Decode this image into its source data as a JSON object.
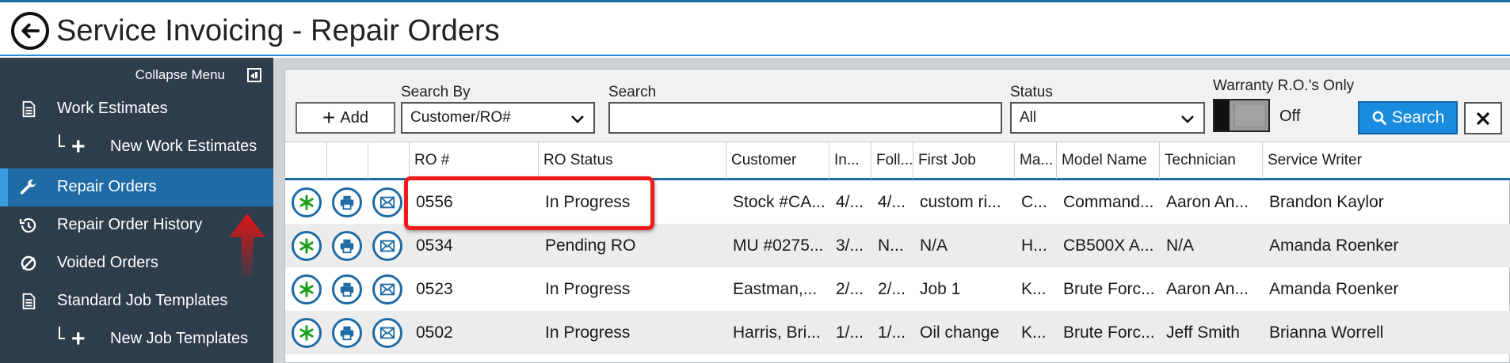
{
  "header": {
    "title": "Service Invoicing - Repair Orders"
  },
  "sidebar": {
    "collapse_label": "Collapse Menu",
    "items": [
      {
        "label": "Work Estimates",
        "icon": "document-icon"
      },
      {
        "label": "New Work Estimates",
        "icon": "plus-icon"
      },
      {
        "label": "Repair Orders",
        "icon": "wrench-icon",
        "active": true
      },
      {
        "label": "Repair Order History",
        "icon": "history-icon"
      },
      {
        "label": "Voided Orders",
        "icon": "void-icon"
      },
      {
        "label": "Standard Job Templates",
        "icon": "document-icon"
      },
      {
        "label": "New Job Templates",
        "icon": "plus-icon"
      }
    ]
  },
  "toolbar": {
    "add_label": "Add",
    "search_by_label": "Search By",
    "search_by_value": "Customer/RO#",
    "search_label": "Search",
    "search_value": "",
    "status_label": "Status",
    "status_value": "All",
    "warranty_label": "Warranty R.O.'s Only",
    "warranty_state": "Off",
    "search_button": "Search"
  },
  "table": {
    "columns": [
      "RO #",
      "RO Status",
      "Customer",
      "In...",
      "Foll...",
      "First Job",
      "Ma...",
      "Model Name",
      "Technician",
      "Service Writer"
    ],
    "rows": [
      [
        "0556",
        "In Progress",
        "Stock #CA...",
        "4/...",
        "4/...",
        "custom ri...",
        "C...",
        "Command...",
        "Aaron An...",
        "Brandon Kaylor"
      ],
      [
        "0534",
        "Pending RO",
        "MU #0275...",
        "3/...",
        "N...",
        "N/A",
        "H...",
        "CB500X A...",
        "N/A",
        "Amanda Roenker"
      ],
      [
        "0523",
        "In Progress",
        "Eastman,...",
        "2/...",
        "2/...",
        "Job 1",
        "K...",
        "Brute Forc...",
        "Aaron An...",
        "Amanda Roenker"
      ],
      [
        "0502",
        "In Progress",
        "Harris, Bri...",
        "1/...",
        "1/...",
        "Oil change",
        "K...",
        "Brute Forc...",
        "Jeff Smith",
        "Brianna Worrell"
      ]
    ]
  },
  "colors": {
    "accent": "#1f6ba5",
    "sidebar": "#2e3d4c",
    "highlight": "#ee1c1c",
    "search_button": "#1a8ce0"
  }
}
